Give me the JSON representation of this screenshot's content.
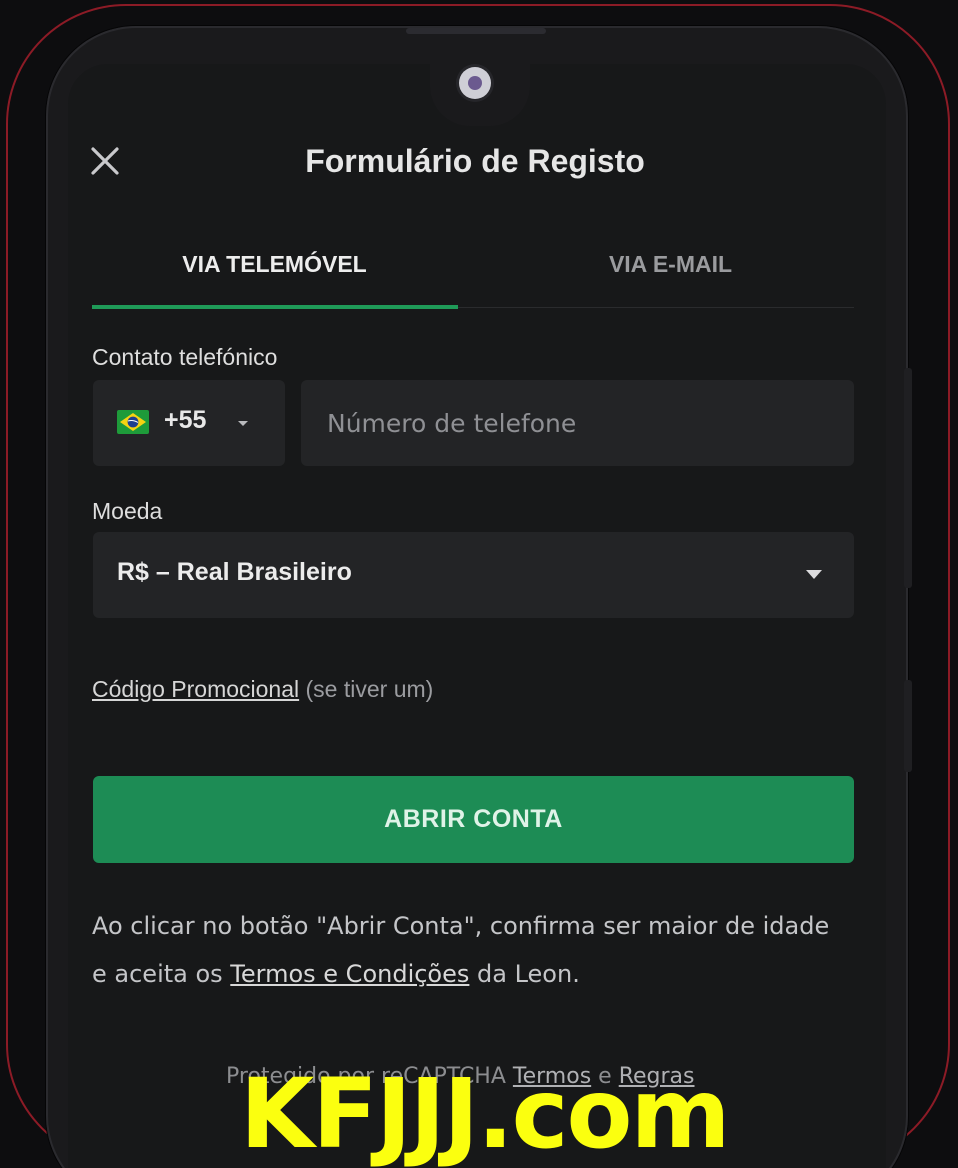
{
  "header": {
    "title": "Formulário de Registo"
  },
  "tabs": [
    {
      "label": "VIA TELEMÓVEL",
      "active": true
    },
    {
      "label": "VIA E-MAIL",
      "active": false
    }
  ],
  "phone": {
    "label": "Contato telefónico",
    "country_code": "+55",
    "placeholder": "Número de telefone",
    "value": ""
  },
  "currency": {
    "label": "Moeda",
    "selected": "R$ – Real Brasileiro"
  },
  "promo": {
    "link_text": "Código Promocional",
    "suffix": "(se tiver um)"
  },
  "submit": {
    "label": "ABRIR CONTA"
  },
  "disclaimer": {
    "text_before": "Ao clicar no botão \"Abrir Conta\", confirma ser maior de idade e aceita os ",
    "link": "Termos e Condições",
    "text_after": " da Leon."
  },
  "recaptcha": {
    "prefix": "Protegido por reCAPTCHA",
    "terms": "Termos",
    "and": "e",
    "rules": "Regras"
  },
  "watermark": "KFJJJ.com",
  "colors": {
    "accent": "#1d8c55",
    "tab_indicator": "#1f9a58",
    "background": "#171819",
    "field": "#232426",
    "frame": "#8c1b26",
    "watermark": "#fbff0f"
  },
  "icons": {
    "close": "close-icon",
    "flag": "brazil-flag-icon",
    "dropdown": "chevron-down-icon"
  }
}
